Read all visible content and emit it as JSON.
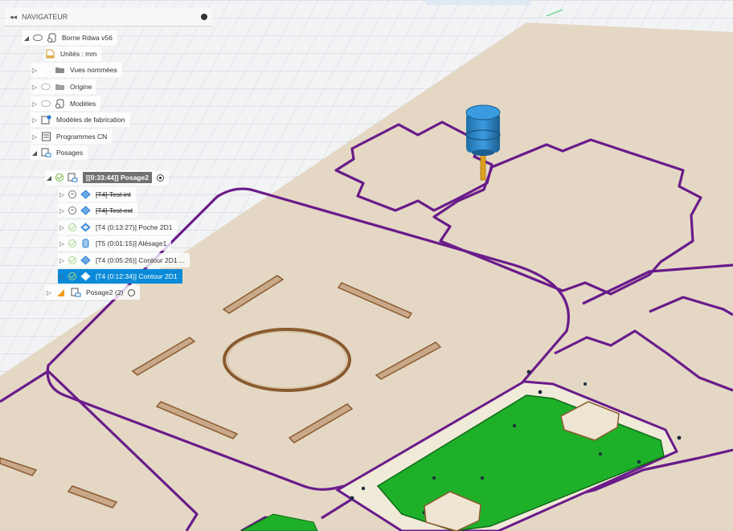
{
  "navigator": {
    "title": "NAVIGATEUR",
    "collapse_glyph": "◂◂",
    "items": [
      {
        "label": "Borne Rdwa v56",
        "icon": "component-icon"
      },
      {
        "label": "Unités : mm",
        "icon": "document-icon"
      },
      {
        "label": "Vues nommées",
        "icon": "folder-icon"
      },
      {
        "label": "Origine",
        "icon": "folder-icon"
      },
      {
        "label": "Modèles",
        "icon": "component-icon"
      },
      {
        "label": "Modèles de fabrication",
        "icon": "manufacturing-model-icon"
      },
      {
        "label": "Programmes CN",
        "icon": "nc-program-icon"
      },
      {
        "label": "Posages",
        "icon": "setup-folder-icon"
      },
      {
        "label": "[[0:33:44]] Posage2",
        "icon": "setup-icon"
      },
      {
        "label": "[T4] Test int",
        "icon": "operation-icon"
      },
      {
        "label": "[T4] Test ext",
        "icon": "operation-icon"
      },
      {
        "label": "[T4 (0:13:27)] Poche 2D1",
        "icon": "pocket-icon"
      },
      {
        "label": "[T5 (0:01:15)] Alésage1",
        "icon": "bore-icon"
      },
      {
        "label": "[T4 (0:05:26)] Contour 2D1 ...",
        "icon": "contour-icon"
      },
      {
        "label": "[T4 (0:12:34)] Contour 2D1",
        "icon": "contour-icon"
      },
      {
        "label": "Posage2 (2)",
        "icon": "setup-icon"
      }
    ]
  },
  "colors": {
    "sheet": "#e4d8c5",
    "toolpath": "#6a1b8a",
    "pocket": "#1fb02a",
    "tool": "#2a88c8",
    "selection": "#0a8ad8",
    "grid": "#c9ccd1"
  }
}
